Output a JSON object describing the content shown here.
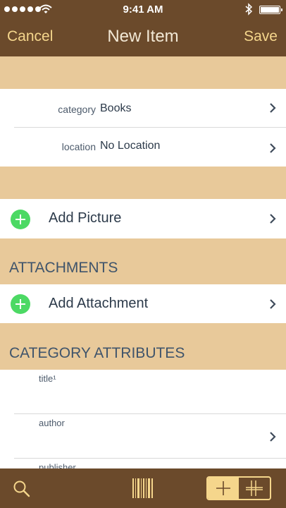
{
  "status_bar": {
    "time": "9:41 AM"
  },
  "nav": {
    "cancel_label": "Cancel",
    "title": "New Item",
    "save_label": "Save"
  },
  "fields": [
    {
      "label": "category",
      "value": "Books"
    },
    {
      "label": "location",
      "value": "No Location"
    }
  ],
  "picture_row": {
    "label": "Add Picture"
  },
  "attachments": {
    "header": "ATTACHMENTS",
    "add_label": "Add Attachment"
  },
  "category_attributes": {
    "header": "CATEGORY ATTRIBUTES",
    "items": [
      "title¹",
      "author",
      "publisher"
    ]
  },
  "toolbar": {
    "icons": [
      "search-icon",
      "barcode-icon",
      "add-icon",
      "add-grid-icon"
    ]
  },
  "colors": {
    "brown": "#6b4a2b",
    "tan": "#e8c99a",
    "accent": "#f5d68c",
    "green": "#4cd964"
  }
}
